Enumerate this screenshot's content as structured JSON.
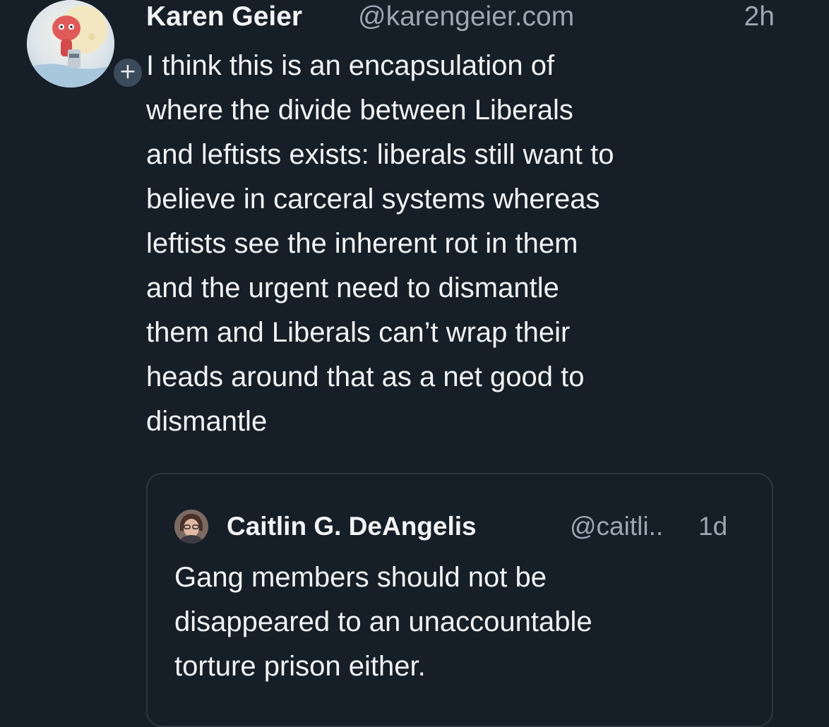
{
  "post": {
    "author_name": "Karen Geier",
    "author_handle": "@karengeier.com",
    "timestamp": "2h",
    "avatar_icon": "avatar-illustration-icon",
    "follow_icon": "plus-icon",
    "follow_symbol": "+",
    "text_lines": [
      "I think this is an encapsulation of",
      "where the divide between Liberals",
      "and leftists exists: liberals still want to",
      "believe in carceral systems whereas",
      "leftists see the inherent rot in them",
      "and the urgent need to dismantle",
      "them and Liberals can’t wrap their",
      "heads around that as a net good to",
      "dismantle"
    ]
  },
  "quoted_post": {
    "author_name": "Caitlin G. DeAngelis",
    "author_handle": "@caitli..",
    "timestamp": "1d",
    "text_lines": [
      "Gang members should not be",
      "disappeared to an unaccountable",
      "torture prison either."
    ]
  },
  "colors": {
    "background": "#161e27",
    "text_primary": "#f1f3f5",
    "text_secondary": "#9ba7b4",
    "quote_border": "#2c3642"
  }
}
